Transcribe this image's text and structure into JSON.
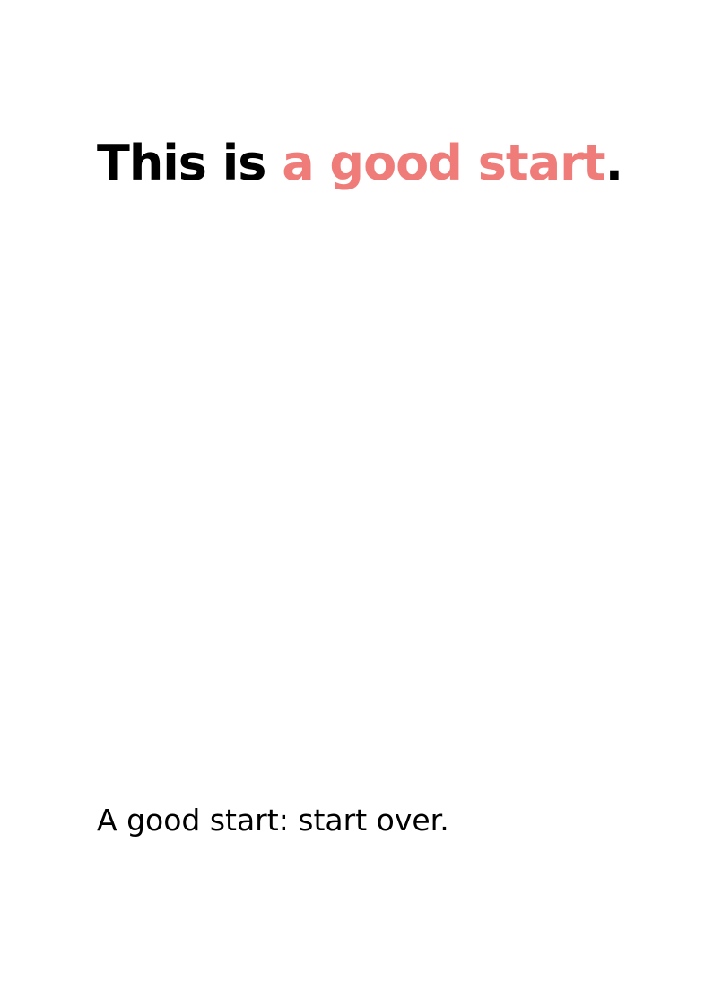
{
  "headline": {
    "prefix": "This is ",
    "highlight": "a good start",
    "suffix": "."
  },
  "tagline": {
    "text": "A good start: start over."
  },
  "colors": {
    "background": "#ffffff",
    "text": "#000000",
    "accent": "#f07c7a"
  }
}
